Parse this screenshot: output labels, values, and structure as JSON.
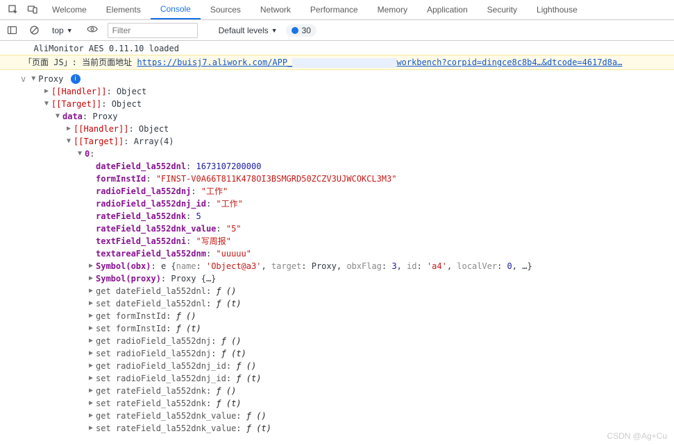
{
  "tabs": {
    "welcome": "Welcome",
    "elements": "Elements",
    "console": "Console",
    "sources": "Sources",
    "network": "Network",
    "performance": "Performance",
    "memory": "Memory",
    "application": "Application",
    "security": "Security",
    "lighthouse": "Lighthouse"
  },
  "toolbar": {
    "context": "top",
    "filter_placeholder": "Filter",
    "levels": "Default levels",
    "issues_count": "30"
  },
  "log": {
    "line1": "  AliMonitor AES 0.11.10 loaded",
    "page_js_label": "「页面 JS」: 当前页面地址 ",
    "url_part1": "https://buisj7.aliwork.com/APP_",
    "url_part2": "workbench?corpid=dingce8c8b4…&dtcode=4617d8a…"
  },
  "tree": {
    "vlabel": "v",
    "proxy_label": "Proxy ",
    "handler": "[[Handler]]",
    "target": "[[Target]]",
    "object_label": ": Object",
    "array4_label": ": Array(4)",
    "zero": "0",
    "data_key": "data",
    "data_val": ": Proxy",
    "props": {
      "dateField_key": "dateField_la552dnl",
      "dateField_val": "1673107200000",
      "formInstId_key": "formInstId",
      "formInstId_val": "\"FINST-V0A66T811K478OI3BSMGRD50ZCZV3UJWCOKCL3M3\"",
      "radioField_key": "radioField_la552dnj",
      "radioField_val": "\"工作\"",
      "radioField_id_key": "radioField_la552dnj_id",
      "radioField_id_val": "\"工作\"",
      "rateField_key": "rateField_la552dnk",
      "rateField_val": "5",
      "rateField_value_key": "rateField_la552dnk_value",
      "rateField_value_val": "\"5\"",
      "textField_key": "textField_la552dni",
      "textField_val": "\"写周报\"",
      "textareaField_key": "textareaField_la552dnm",
      "textareaField_val": "\"uuuuu\""
    },
    "symbol_obx_key": "Symbol(obx)",
    "symbol_obx_preview": {
      "e": "e ",
      "open": "{",
      "name_k": "name",
      "name_v": "'Object@a3'",
      "target_k": "target",
      "target_v": "Proxy",
      "obxFlag_k": "obxFlag",
      "obxFlag_v": "3",
      "id_k": "id",
      "id_v": "'a4'",
      "localVer_k": "localVer",
      "localVer_v": "0",
      "rest": ", …}"
    },
    "symbol_proxy_key": "Symbol(proxy)",
    "symbol_proxy_val": "Proxy {…}",
    "accessors": [
      {
        "k": "get dateField_la552dnl",
        "v": "ƒ ()"
      },
      {
        "k": "set dateField_la552dnl",
        "v": "ƒ (t)"
      },
      {
        "k": "get formInstId",
        "v": "ƒ ()"
      },
      {
        "k": "set formInstId",
        "v": "ƒ (t)"
      },
      {
        "k": "get radioField_la552dnj",
        "v": "ƒ ()"
      },
      {
        "k": "set radioField_la552dnj",
        "v": "ƒ (t)"
      },
      {
        "k": "get radioField_la552dnj_id",
        "v": "ƒ ()"
      },
      {
        "k": "set radioField_la552dnj_id",
        "v": "ƒ (t)"
      },
      {
        "k": "get rateField_la552dnk",
        "v": "ƒ ()"
      },
      {
        "k": "set rateField_la552dnk",
        "v": "ƒ (t)"
      },
      {
        "k": "get rateField_la552dnk_value",
        "v": "ƒ ()"
      },
      {
        "k": "set rateField_la552dnk_value",
        "v": "ƒ (t)"
      }
    ]
  },
  "watermark": "CSDN @Ag+Cu"
}
